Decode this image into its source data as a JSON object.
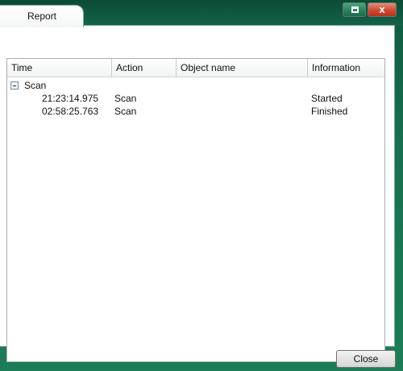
{
  "window": {
    "tab_label": "Report",
    "restore_icon": "restore-icon",
    "close_glyph": "x"
  },
  "table": {
    "columns": [
      "Time",
      "Action",
      "Object name",
      "Information"
    ],
    "group": {
      "label": "Scan",
      "expanded": true
    },
    "rows": [
      {
        "time": "21:23:14.975",
        "action": "Scan",
        "object": "",
        "info": "Started"
      },
      {
        "time": "02:58:25.763",
        "action": "Scan",
        "object": "",
        "info": "Finished"
      }
    ]
  },
  "footer": {
    "close_label": "Close"
  },
  "colors": {
    "frame": "#17704f",
    "close_red": "#cf4a35"
  }
}
